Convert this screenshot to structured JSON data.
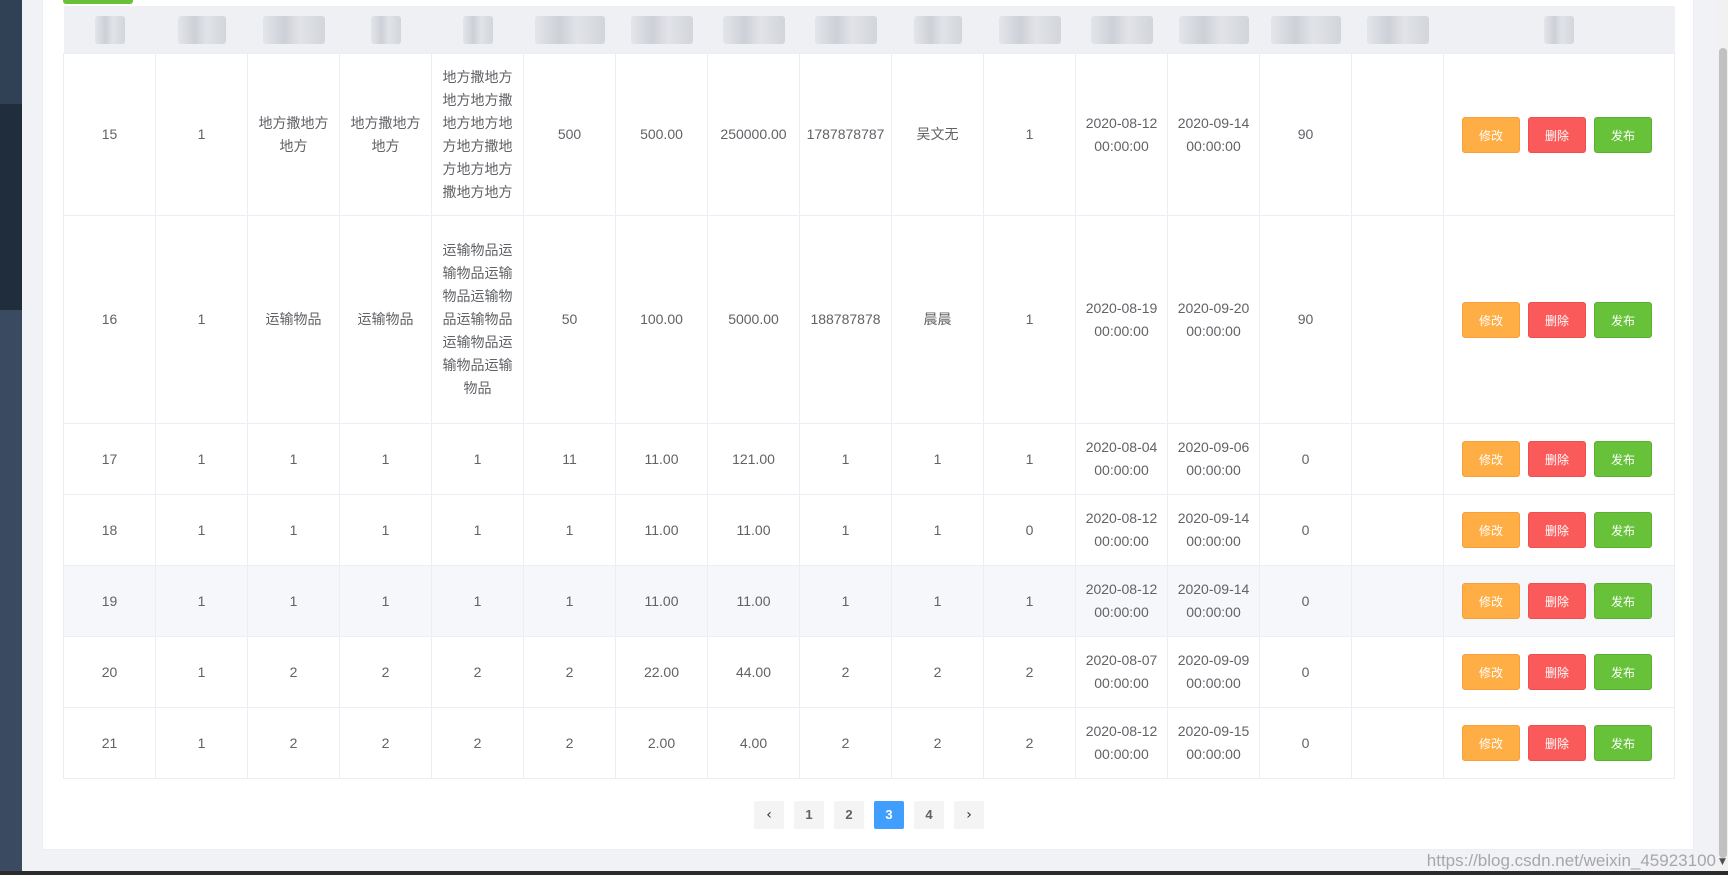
{
  "table": {
    "rows": [
      {
        "cells": [
          "15",
          "1",
          "地方撒地方地方",
          "地方撒地方地方",
          "地方撒地方地方地方撒地方地方地方地方撒地方地方地方撒地方地方",
          "500",
          "500.00",
          "250000.00",
          "1787878787",
          "吴文无",
          "1",
          "2020-08-12 00:00:00",
          "2020-09-14 00:00:00",
          "90",
          ""
        ]
      },
      {
        "cells": [
          "16",
          "1",
          "运输物品",
          "运输物品",
          "运输物品运输物品运输物品运输物品运输物品运输物品运输物品运输物品",
          "50",
          "100.00",
          "5000.00",
          "188787878",
          "晨晨",
          "1",
          "2020-08-19 00:00:00",
          "2020-09-20 00:00:00",
          "90",
          ""
        ]
      },
      {
        "cells": [
          "17",
          "1",
          "1",
          "1",
          "1",
          "11",
          "11.00",
          "121.00",
          "1",
          "1",
          "1",
          "2020-08-04 00:00:00",
          "2020-09-06 00:00:00",
          "0",
          ""
        ]
      },
      {
        "cells": [
          "18",
          "1",
          "1",
          "1",
          "1",
          "1",
          "11.00",
          "11.00",
          "1",
          "1",
          "0",
          "2020-08-12 00:00:00",
          "2020-09-14 00:00:00",
          "0",
          ""
        ]
      },
      {
        "cells": [
          "19",
          "1",
          "1",
          "1",
          "1",
          "1",
          "11.00",
          "11.00",
          "1",
          "1",
          "1",
          "2020-08-12 00:00:00",
          "2020-09-14 00:00:00",
          "0",
          ""
        ]
      },
      {
        "cells": [
          "20",
          "1",
          "2",
          "2",
          "2",
          "2",
          "22.00",
          "44.00",
          "2",
          "2",
          "2",
          "2020-08-07 00:00:00",
          "2020-09-09 00:00:00",
          "0",
          ""
        ]
      },
      {
        "cells": [
          "21",
          "1",
          "2",
          "2",
          "2",
          "2",
          "2.00",
          "4.00",
          "2",
          "2",
          "2",
          "2020-08-12 00:00:00",
          "2020-09-15 00:00:00",
          "0",
          ""
        ]
      }
    ]
  },
  "actions": {
    "edit_label": "修改",
    "delete_label": "删除",
    "publish_label": "发布"
  },
  "pagination": {
    "prev": "‹",
    "next": "›",
    "pages": [
      "1",
      "2",
      "3",
      "4"
    ],
    "current": "3"
  },
  "watermark": "https://blog.csdn.net/weixin_45923100",
  "colors": {
    "edit": "#ffad45",
    "delete": "#fa5a5a",
    "publish": "#67c23a",
    "active_page": "#409eff",
    "sidebar": "#304156"
  }
}
